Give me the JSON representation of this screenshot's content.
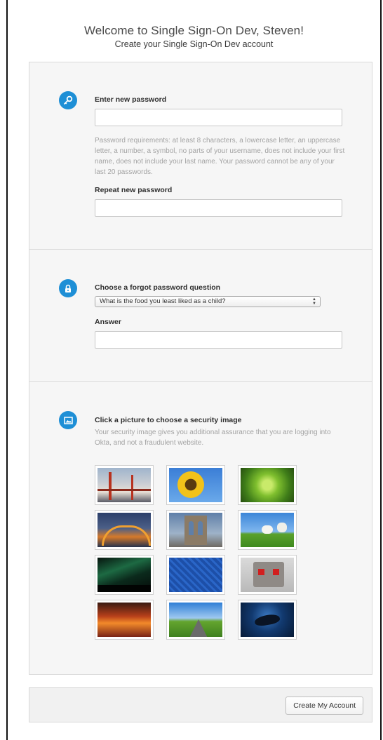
{
  "header": {
    "title": "Welcome to Single Sign-On Dev, Steven!",
    "subtitle": "Create your Single Sign-On Dev account"
  },
  "password_section": {
    "icon": "key-icon",
    "label": "Enter new password",
    "password_value": "",
    "requirements": "Password requirements: at least 8 characters, a lowercase letter, an uppercase letter, a number, a symbol, no parts of your username, does not include your first name, does not include your last name. Your password cannot be any of your last 20 passwords.",
    "repeat_label": "Repeat new password",
    "repeat_value": ""
  },
  "question_section": {
    "icon": "lock-icon",
    "label": "Choose a forgot password question",
    "selected_question": "What is the food you least liked as a child?",
    "answer_label": "Answer",
    "answer_value": ""
  },
  "image_section": {
    "icon": "image-icon",
    "label": "Click a picture to choose a security image",
    "description": "Your security image gives you additional assurance that you are logging into Okta, and not a fraudulent website.",
    "images": [
      "golden-gate-bridge",
      "sunflower",
      "succulent-plant",
      "harbour-bridge-night",
      "brooklyn-bridge",
      "sheep-meadow",
      "northern-lights",
      "circuit-board",
      "robot-face",
      "sunset-clouds",
      "open-road",
      "manta-ray"
    ]
  },
  "footer": {
    "submit_label": "Create My Account"
  },
  "colors": {
    "accent": "#1e8fd6",
    "panel_bg": "#f6f6f6"
  }
}
